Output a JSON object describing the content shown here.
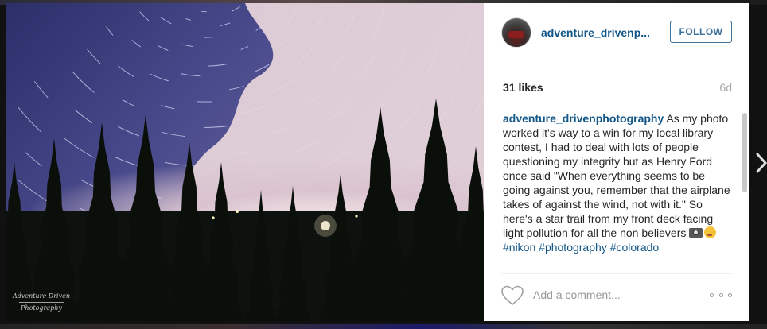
{
  "photo": {
    "watermark_line1": "Adventure Driven",
    "watermark_line2": "Photography"
  },
  "post": {
    "username": "adventure_drivenp...",
    "follow_label": "FOLLOW",
    "likes": "31 likes",
    "age": "6d",
    "caption_user": "adventure_drivenphotography",
    "caption_text": "As my photo worked it's way to a win for my local library contest, I had to deal with lots of people questioning my integrity but as Henry Ford once said \"When everything seems to be going against you, remember that the airplane takes of against the wind, not with it.\" So here's a star trail from my front deck facing light pollution for all the non believers",
    "hashtags": [
      "#nikon",
      "#photography",
      "#colorado"
    ]
  },
  "comment": {
    "placeholder": "Add a comment..."
  },
  "icons": {
    "like": "heart-icon",
    "more": "more-options-icon",
    "next": "chevron-right-icon",
    "emoji1": "camera-emoji",
    "emoji2": "kissing-face-emoji"
  },
  "colors": {
    "link": "#125688",
    "follow": "#3f729b",
    "muted": "#a5a7aa"
  }
}
